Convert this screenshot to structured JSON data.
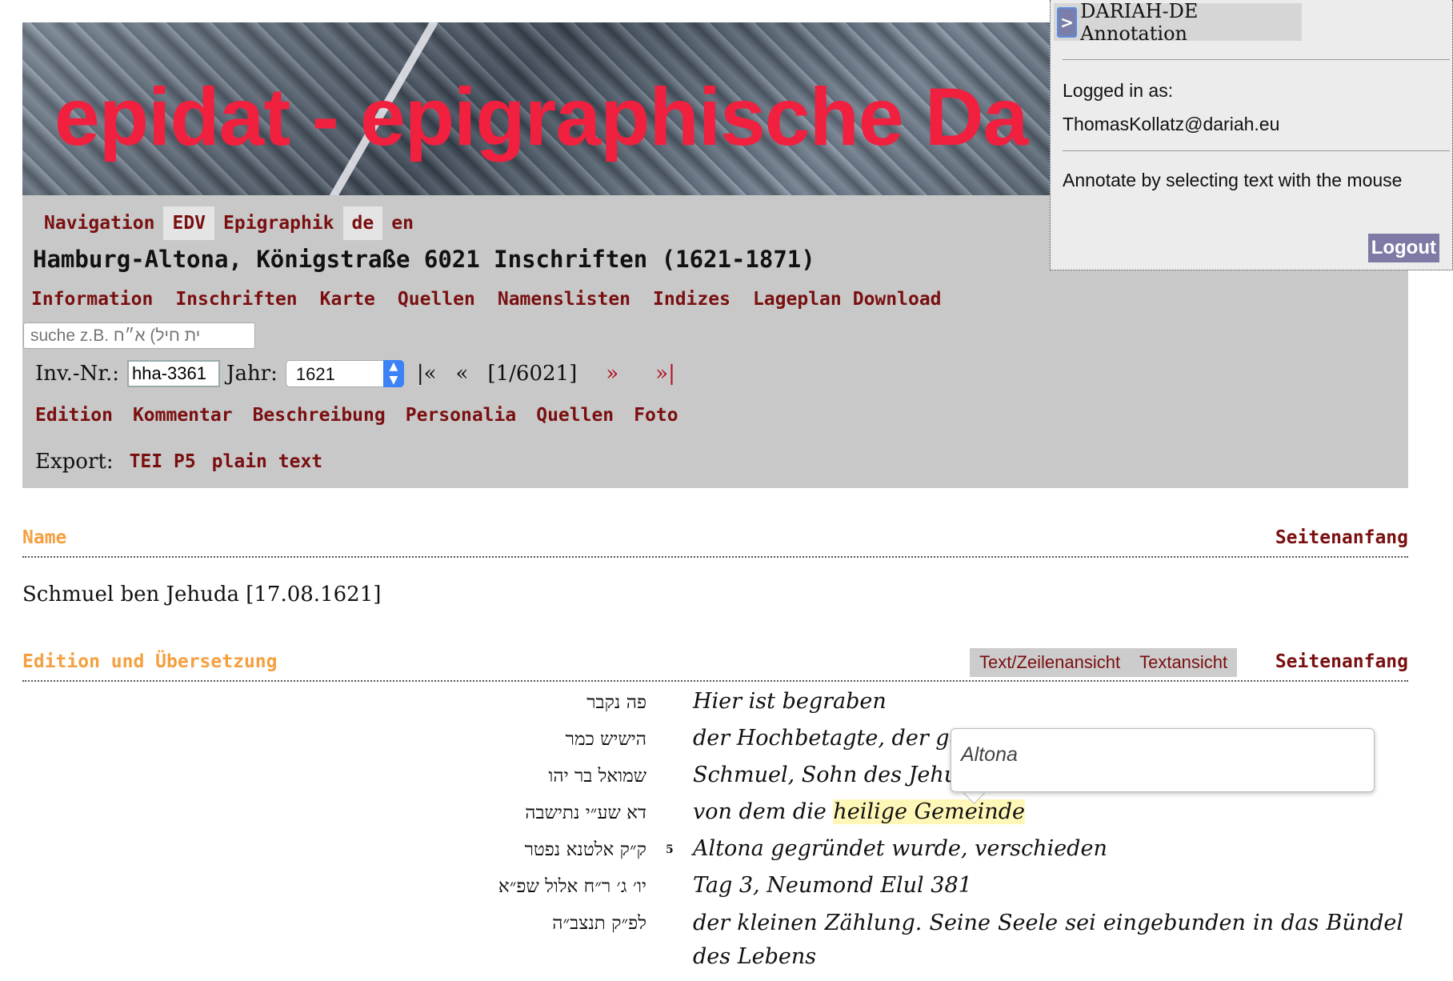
{
  "banner": {
    "title": "epidat - epigraphische Da"
  },
  "nav": [
    "Navigation",
    "EDV",
    "Epigraphik",
    "de",
    "en"
  ],
  "site_title": "Hamburg-Altona, Königstraße 6021 Inschriften (1621-1871)",
  "menu": [
    "Information",
    "Inschriften",
    "Karte",
    "Quellen",
    "Namenslisten",
    "Indizes",
    "Lageplan",
    "Download"
  ],
  "search": {
    "placeholder": "suche z.B. ית חיל) א״ח"
  },
  "pager": {
    "inv_label": "Inv.-Nr.:",
    "inv_value": "hha-3361",
    "year_label": "Jahr:",
    "year_value": "1621",
    "first": "|«",
    "prev": "«",
    "position": "[1/6021]",
    "next": "»",
    "last": "»|"
  },
  "tabs": [
    "Edition",
    "Kommentar",
    "Beschreibung",
    "Personalia",
    "Quellen",
    "Foto"
  ],
  "export": {
    "label": "Export:",
    "tei": "TEI P5",
    "plain": "plain text"
  },
  "annotation": {
    "toggle": ">",
    "title": "DARIAH-DE Annotation",
    "logged_in_label": "Logged in as:",
    "user": "ThomasKollatz@dariah.eu",
    "hint": "Annotate by selecting text with the mouse",
    "logout": "Logout"
  },
  "name_section": {
    "title": "Name",
    "top_link": "Seitenanfang",
    "value": "Schmuel ben Jehuda [17.08.1621]"
  },
  "edition_section": {
    "title": "Edition und Übersetzung",
    "view_line": "Text/Zeilenansicht",
    "view_text": "Textansicht",
    "top_link": "Seitenanfang"
  },
  "edition_lines": {
    "hebrew": [
      "פה נקבר",
      "הישיש כמר",
      "שמואל בר יהו",
      "דא שע״י נתישבה",
      "ק״ק אלטנא נפטר",
      "יו׳ ג׳ ר״ח אלול שפ״א",
      "לפ״ק תנצב״ה"
    ],
    "german": [
      "Hier ist begraben",
      "der Hochbetagte, der geel",
      "Schmuel, Sohn des Jehuda",
      "von dem die",
      "Altona gegründet wurde, verschieden",
      "Tag 3, Neumond Elul 381",
      "der kleinen Zählung. Seine Seele sei eingebunden in das Bündel des Lebens"
    ],
    "highlight": "heilige Gemeinde",
    "line_number": "5"
  },
  "popup": {
    "text": "Altona"
  }
}
